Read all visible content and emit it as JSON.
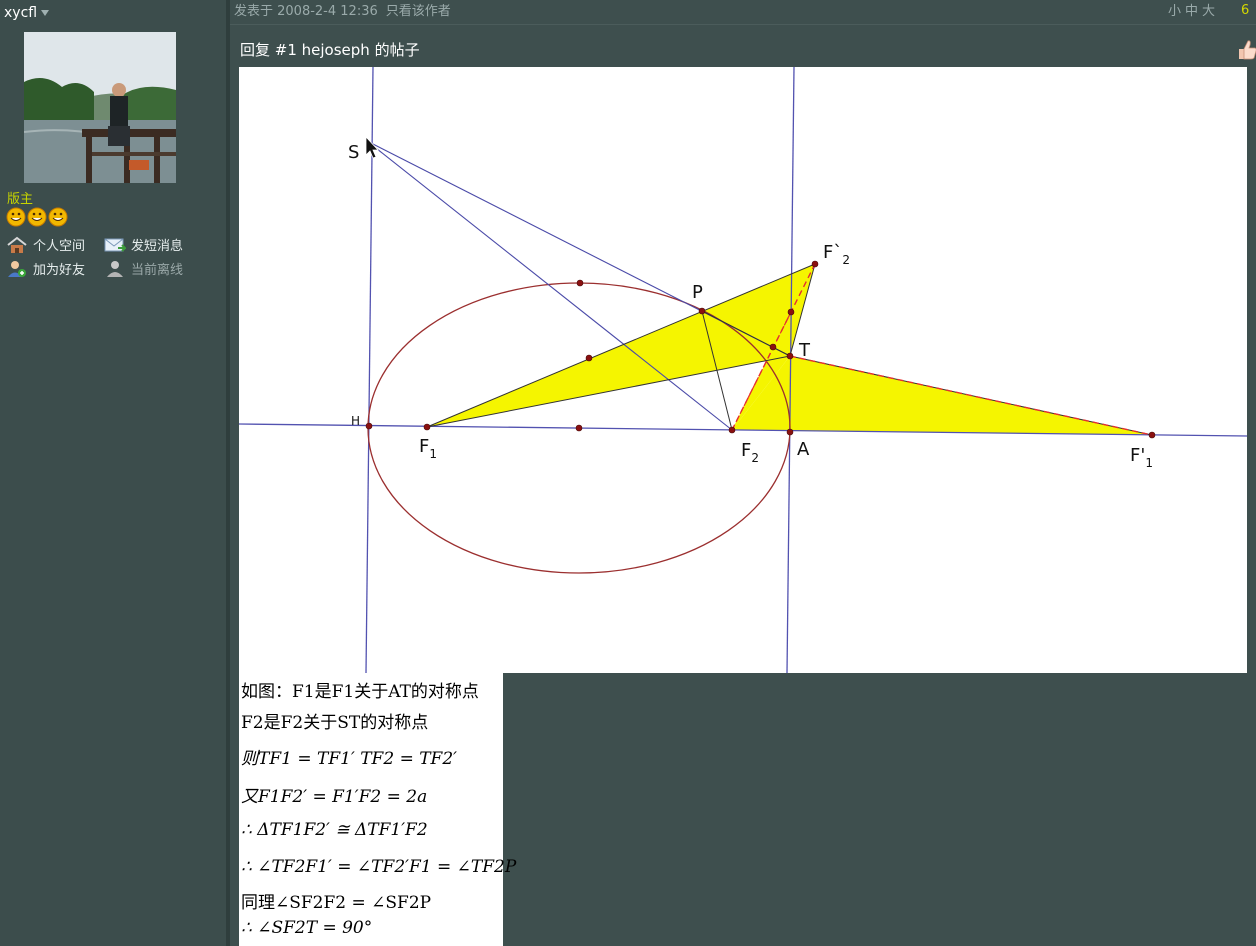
{
  "author": {
    "name": "xycfl",
    "role": "版主"
  },
  "profile_links": [
    {
      "label": "个人空间",
      "icon": "home-icon"
    },
    {
      "label": "发短消息",
      "icon": "message-icon"
    },
    {
      "label": "加为好友",
      "icon": "add-friend-icon"
    },
    {
      "label": "当前离线",
      "icon": "offline-icon"
    }
  ],
  "post": {
    "posted_at": "发表于 2008-2-4 12:36",
    "only_author": "只看该作者",
    "font_small": "小",
    "font_medium": "中",
    "font_large": "大",
    "floor": "6",
    "title": "回复 #1 hejoseph 的帖子"
  },
  "figure_labels": {
    "S": "S",
    "P": "P",
    "T": "T",
    "H": "H",
    "A": "A",
    "F1": "F",
    "F1_sub": "1",
    "F2": "F",
    "F2_sub": "2",
    "F2prime": "F`",
    "F2prime_sub": "2",
    "F1prime": "F'",
    "F1prime_sub": "1"
  },
  "proof_lines": [
    "如图：F1是F1关于AT的对称点",
    "F2是F2关于ST的对称点",
    "则TF1 = TF1′    TF2 = TF2′",
    "又F1F2′ = F1′F2 = 2a",
    "∴   ΔTF1F2′ ≅ ΔTF1′F2",
    "∴   ∠TF2F1′ = ∠TF2′F1 = ∠TF2P",
    "同理∠SF2F2 = ∠SF2P",
    "∴   ∠SF2T = 90°"
  ],
  "colors": {
    "background": "#3e4f4e",
    "accent_yellow": "#c6d400",
    "triangle_fill": "#f5f500",
    "ellipse": "#9b2f2f",
    "line_blue": "#4a4aa8",
    "dashed_red": "#e63030"
  }
}
